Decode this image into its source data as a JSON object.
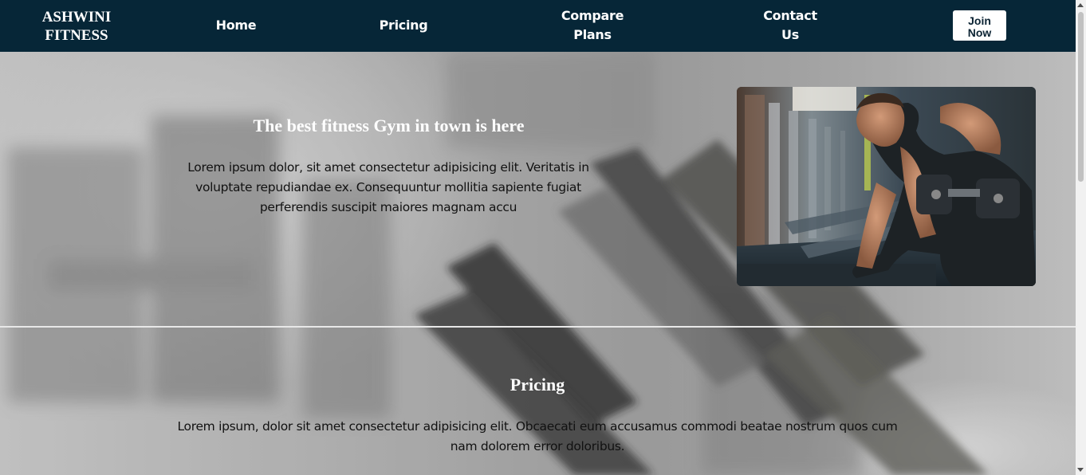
{
  "navbar": {
    "brand": [
      "ASHWINI",
      "FITNESS"
    ],
    "links": [
      {
        "label": "Home"
      },
      {
        "label": "Pricing"
      },
      {
        "label": [
          "Compare",
          "Plans"
        ]
      },
      {
        "label": [
          "Contact",
          "Us"
        ]
      }
    ],
    "join_button": [
      "Join",
      "Now"
    ],
    "background_color": "#062637"
  },
  "hero": {
    "title": "The best fitness Gym in town is here",
    "text": "Lorem ipsum dolor, sit amet consectetur adipisicing elit. Veritatis in voluptate repudiandae ex. Consequuntur mollitia sapiente fugiat perferendis suscipit maiores magnam accu",
    "image_icon": "gym-photo"
  },
  "pricing": {
    "title": "Pricing",
    "text": "Lorem ipsum, dolor sit amet consectetur adipisicing elit. Obcaecati eum accusamus commodi beatae nostrum quos cum nam dolorem error doloribus."
  }
}
